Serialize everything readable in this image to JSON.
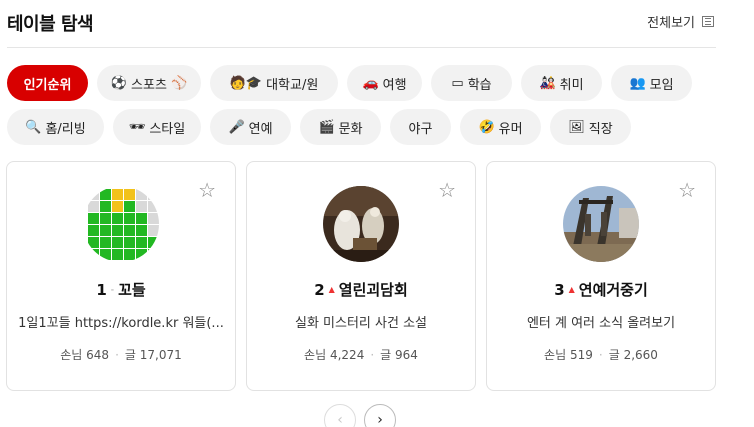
{
  "header": {
    "title": "테이블 탐색",
    "view_all": "전체보기"
  },
  "chips_row1": [
    {
      "label": "인기순위",
      "icon": "",
      "active": true
    },
    {
      "label": "스포츠",
      "icon": "⚽",
      "icon2": "⚾"
    },
    {
      "label": "대학교/원",
      "icon": "🧑🎓"
    },
    {
      "label": "여행",
      "icon": "🚗"
    },
    {
      "label": "학습",
      "icon": "▭"
    },
    {
      "label": "취미",
      "icon": "🎎"
    },
    {
      "label": "모임",
      "icon": "👥"
    }
  ],
  "chips_row2": [
    {
      "label": "홈/리빙",
      "icon": "🔍"
    },
    {
      "label": "스타일",
      "icon": "🕶"
    },
    {
      "label": "연예",
      "icon": "🎤"
    },
    {
      "label": "문화",
      "icon": "🎬"
    },
    {
      "label": "야구",
      "icon": ""
    },
    {
      "label": "유머",
      "icon": "🤣"
    },
    {
      "label": "직장",
      "icon": "🖼"
    }
  ],
  "cards": [
    {
      "rank": "1",
      "trend": "same",
      "name": "꼬들",
      "desc": "1일1꼬들 https://kordle.kr 워들(...",
      "guests_label": "손님",
      "guests": "648",
      "posts_label": "글",
      "posts": "17,071"
    },
    {
      "rank": "2",
      "trend": "up",
      "name": "열린괴담회",
      "desc": "실화 미스터리 사건 소설",
      "guests_label": "손님",
      "guests": "4,224",
      "posts_label": "글",
      "posts": "964"
    },
    {
      "rank": "3",
      "trend": "up",
      "name": "연예거중기",
      "desc": "엔터 계 여러 소식 올려보기",
      "guests_label": "손님",
      "guests": "519",
      "posts_label": "글",
      "posts": "2,660"
    }
  ],
  "pager": {
    "prev": "‹",
    "next": "›"
  },
  "colors": {
    "accent": "#d80000"
  }
}
